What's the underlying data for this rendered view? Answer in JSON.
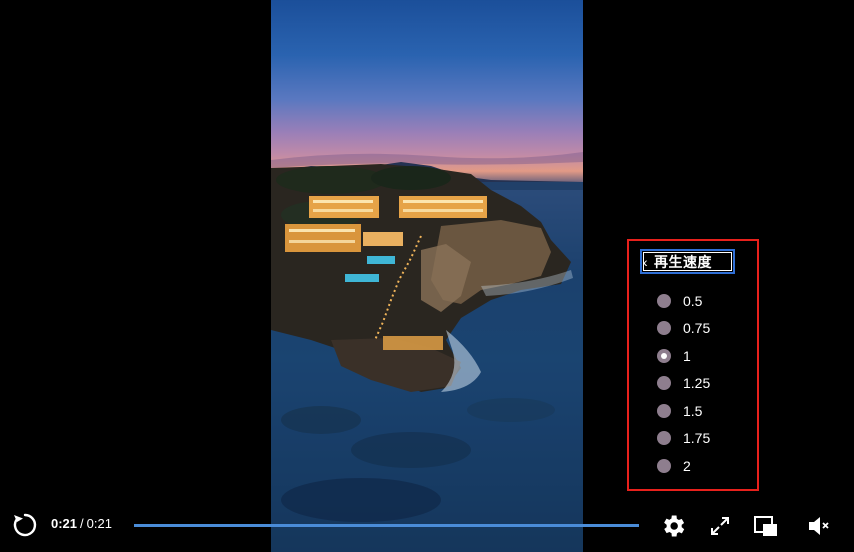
{
  "player": {
    "current_time": "0:21",
    "separator": "/",
    "duration": "0:21",
    "progress_fraction": 1.0
  },
  "speed_menu": {
    "back_icon": "chevron-left-icon",
    "title": "再生速度",
    "options": [
      {
        "label": "0.5",
        "selected": false
      },
      {
        "label": "0.75",
        "selected": false
      },
      {
        "label": "1",
        "selected": true
      },
      {
        "label": "1.25",
        "selected": false
      },
      {
        "label": "1.5",
        "selected": false
      },
      {
        "label": "1.75",
        "selected": false
      },
      {
        "label": "2",
        "selected": false
      }
    ],
    "highlight_color": "#e8211c",
    "focus_color": "#2f6fd6"
  },
  "controls": {
    "replay_icon": "replay-icon",
    "settings_icon": "gear-icon",
    "fullscreen_icon": "fullscreen-icon",
    "pip_icon": "picture-in-picture-icon",
    "mute_icon": "speaker-muted-icon",
    "progress_color": "#4a8cd8"
  }
}
